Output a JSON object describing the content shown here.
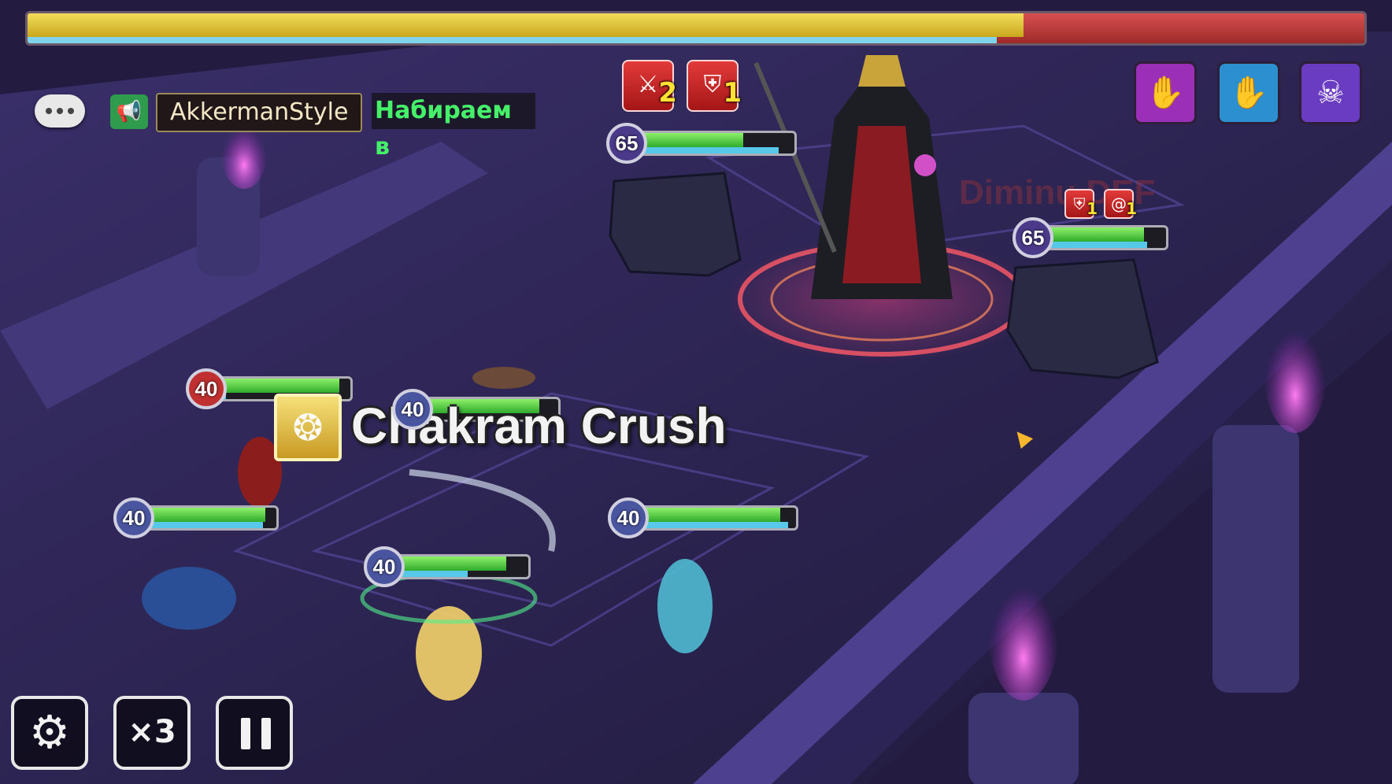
{
  "boss_bar": {
    "hp_fraction": 0.745,
    "turn_fraction": 0.725,
    "hp_color": "#e9cf43",
    "missing_hp_color": "#c53c3c",
    "atb_color": "#7fd3ea"
  },
  "chat": {
    "icon": "speech-bubble-icon",
    "megaphone_icon": "megaphone-icon",
    "megaphone_glyph": "📢",
    "username": "AkkermanStyle",
    "message": "Набираем в"
  },
  "boss_debuffs": [
    {
      "icon": "attack-break-icon",
      "glyph": "⚔",
      "turns": "2"
    },
    {
      "icon": "defense-break-icon",
      "glyph": "⛨",
      "turns": "1"
    }
  ],
  "golem_debuffs": [
    {
      "icon": "defense-break-icon",
      "glyph": "⛨",
      "turns": "1"
    },
    {
      "icon": "brand-icon",
      "glyph": "@",
      "turns": "1"
    }
  ],
  "boss_skills": [
    {
      "icon": "hand-skill-icon",
      "glyph": "✋",
      "color": "#9c2fb8"
    },
    {
      "icon": "blue-hand-skill-icon",
      "glyph": "✋",
      "color": "#2b8fd0"
    },
    {
      "icon": "skull-skill-icon",
      "glyph": "☠",
      "color": "#6a3cc2"
    }
  ],
  "status_text": "Diminu DEF",
  "enemies": [
    {
      "name": "golem-left",
      "level": "65",
      "hp": 0.68,
      "atb": 0.9,
      "lvl_color": "#4b3a8a"
    },
    {
      "name": "golem-right",
      "level": "65",
      "hp": 0.82,
      "atb": 0.85,
      "lvl_color": "#4b3a8a"
    }
  ],
  "allies": [
    {
      "name": "ally-red",
      "level": "40",
      "hp": 0.92,
      "atb": 0.08,
      "lvl_color": "#c03030"
    },
    {
      "name": "ally-wind",
      "level": "40",
      "hp": 0.86,
      "atb": 0.1,
      "lvl_color": "#4a55a0"
    },
    {
      "name": "ally-left",
      "level": "40",
      "hp": 0.92,
      "atb": 0.9,
      "lvl_color": "#4a55a0"
    },
    {
      "name": "ally-center",
      "level": "40",
      "hp": 0.84,
      "atb": 0.55,
      "lvl_color": "#4a55a0"
    },
    {
      "name": "ally-right",
      "level": "40",
      "hp": 0.9,
      "atb": 0.95,
      "lvl_color": "#4a55a0"
    }
  ],
  "skill_banner": {
    "icon": "chakram-skill-icon",
    "glyph": "❂",
    "name": "Chakram Crush"
  },
  "controls": {
    "settings_icon": "gear-icon",
    "settings_glyph": "⚙",
    "speed_label": "×3",
    "pause_icon": "pause-icon"
  }
}
